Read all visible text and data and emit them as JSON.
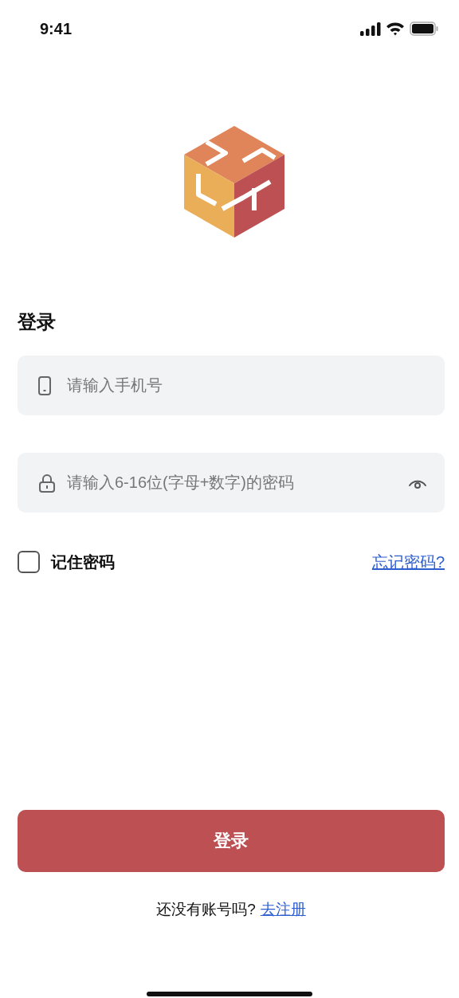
{
  "status_bar": {
    "time": "9:41"
  },
  "title": "登录",
  "fields": [
    {
      "kind": "phone",
      "placeholder": "请输入手机号"
    },
    {
      "kind": "password",
      "placeholder": "请输入6-16位(字母+数字)的密码"
    }
  ],
  "remember": {
    "label": "记住密码",
    "checked": false
  },
  "forgot_link": "忘记密码?",
  "login_button": "登录",
  "register": {
    "prompt": "还没有账号吗?",
    "link": "去注册"
  }
}
